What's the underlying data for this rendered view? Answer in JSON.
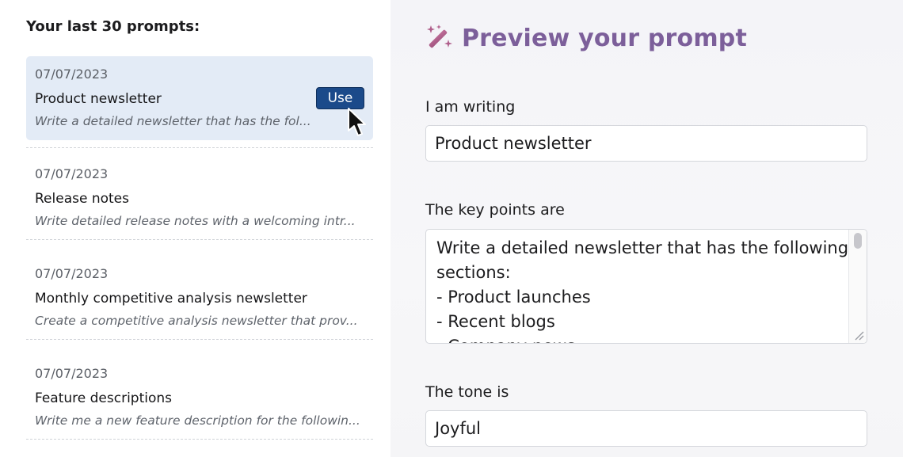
{
  "left_panel": {
    "title": "Your last 30 prompts:",
    "use_label": "Use",
    "prompts": [
      {
        "date": "07/07/2023",
        "name": "Product newsletter",
        "desc": "Write a detailed newsletter that has the fol..."
      },
      {
        "date": "07/07/2023",
        "name": "Release notes",
        "desc": "Write detailed release notes with a welcoming intr..."
      },
      {
        "date": "07/07/2023",
        "name": "Monthly competitive analysis newsletter",
        "desc": "Create a competitive analysis newsletter that prov..."
      },
      {
        "date": "07/07/2023",
        "name": "Feature descriptions",
        "desc": "Write me a new feature description for the followin..."
      }
    ]
  },
  "preview": {
    "title": "Preview your prompt",
    "icon": "magic-wand-icon",
    "writing_label": "I am writing",
    "writing_value": "Product newsletter",
    "key_points_label": "The key points are",
    "key_points_lines": [
      "Write a detailed newsletter that has the following",
      "sections:",
      "- Product launches",
      "- Recent blogs",
      "- Company news"
    ],
    "tone_label": "The tone is",
    "tone_value": "Joyful"
  },
  "colors": {
    "accent_button": "#1b4a8a",
    "active_item_bg": "#e3ebf6",
    "title_gradient_start": "#a0537e",
    "title_gradient_end": "#5f6fae"
  }
}
